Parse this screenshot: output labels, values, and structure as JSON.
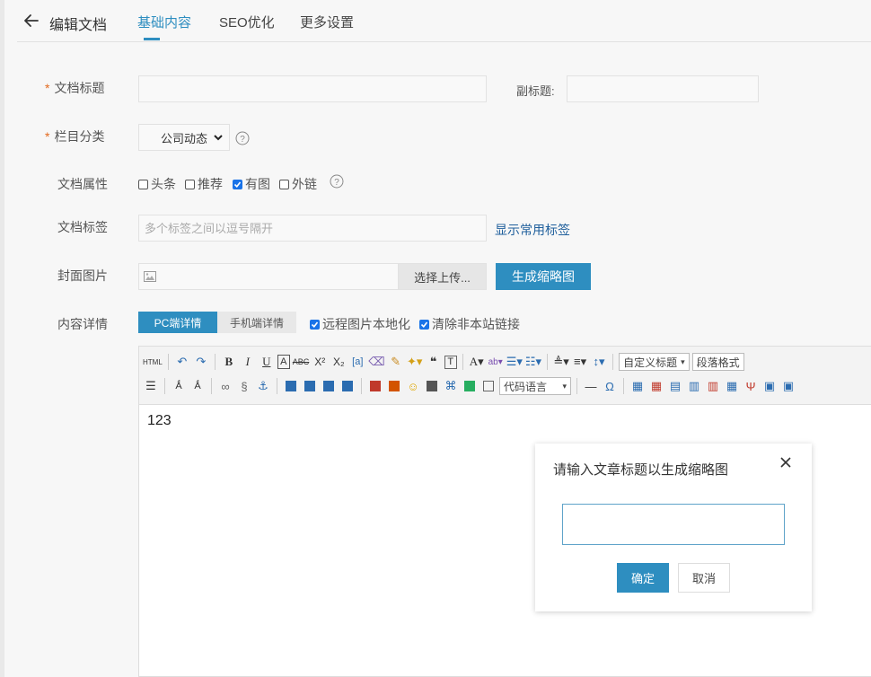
{
  "header": {
    "title": "编辑文档",
    "tabs": [
      {
        "label": "基础内容"
      },
      {
        "label": "SEO优化"
      },
      {
        "label": "更多设置"
      }
    ]
  },
  "form": {
    "required_mark": "*",
    "title_label": "文档标题",
    "title_value": "",
    "subtitle_label": "副标题:",
    "subtitle_value": "",
    "category_label": "栏目分类",
    "category_value": "公司动态",
    "attr_label": "文档属性",
    "attrs": [
      {
        "label": "头条",
        "checked": false
      },
      {
        "label": "推荐",
        "checked": false
      },
      {
        "label": "有图",
        "checked": true
      },
      {
        "label": "外链",
        "checked": false
      }
    ],
    "tags_label": "文档标签",
    "tags_placeholder": "多个标签之间以逗号隔开",
    "show_tags_link": "显示常用标签",
    "cover_label": "封面图片",
    "upload_button": "选择上传...",
    "thumb_button": "生成缩略图",
    "content_label": "内容详情",
    "content_tabs": [
      {
        "label": "PC端详情"
      },
      {
        "label": "手机端详情"
      }
    ],
    "remote_image_label": "远程图片本地化",
    "remote_image_checked": true,
    "clear_links_label": "清除非本站链接",
    "clear_links_checked": true
  },
  "editor": {
    "html_button": "HTML",
    "custom_title_select": "自定义标题",
    "paragraph_select": "段落格式",
    "code_lang_select": "代码语言",
    "content": "123"
  },
  "modal": {
    "title": "请输入文章标题以生成缩略图",
    "input_value": "",
    "ok_label": "确定",
    "cancel_label": "取消"
  },
  "colors": {
    "accent": "#2e8ec0",
    "required": "#e36a1f",
    "link": "#1f5f9c",
    "checkbox_checked": "#1a73e8"
  }
}
